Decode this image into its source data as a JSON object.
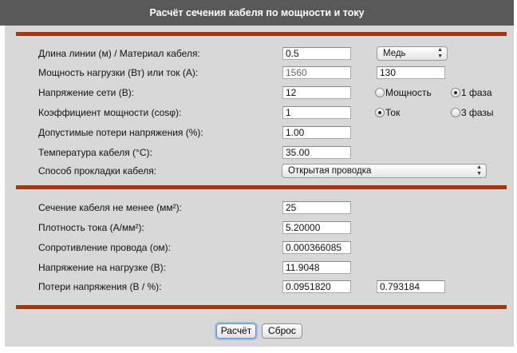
{
  "title": "Расчёт сечения кабеля по мощности и току",
  "inputs": {
    "length_label": "Длина линии (м) / Материал кабеля:",
    "length_value": "0.5",
    "material": "Медь",
    "load_label": "Мощность нагрузки (Вт) или ток (А):",
    "power_value": "1560",
    "current_value": "130",
    "voltage_label": "Напряжение сети (В):",
    "voltage_value": "12",
    "pf_label": "Коэффициент мощности (cosφ):",
    "pf_value": "1",
    "loss_label": "Допустимые потери напряжения (%):",
    "loss_value": "1.00",
    "temp_label": "Температура кабеля (°С):",
    "temp_value": "35.00",
    "method_label": "Способ прокладки кабеля:",
    "method_value": "Открытая проводка"
  },
  "radios": {
    "power": {
      "label": "Мощность",
      "checked": false
    },
    "current": {
      "label": "Ток",
      "checked": true
    },
    "phase1": {
      "label": "1 фаза",
      "checked": true
    },
    "phase3": {
      "label": "3 фазы",
      "checked": false
    }
  },
  "results": {
    "section_label": "Сечение кабеля не менее (мм²):",
    "section_value": "25",
    "density_label": "Плотность тока (А/мм²):",
    "density_value": "5.20000",
    "resistance_label": "Сопротивление провода (ом):",
    "resistance_value": "0.000366085",
    "load_voltage_label": "Напряжение на нагрузке (В):",
    "load_voltage_value": "11.9048",
    "drop_label": "Потери напряжения (В / %):",
    "drop_v_value": "0.0951820",
    "drop_pct_value": "0.793184"
  },
  "buttons": {
    "calc": "Расчёт",
    "reset": "Сброс"
  }
}
